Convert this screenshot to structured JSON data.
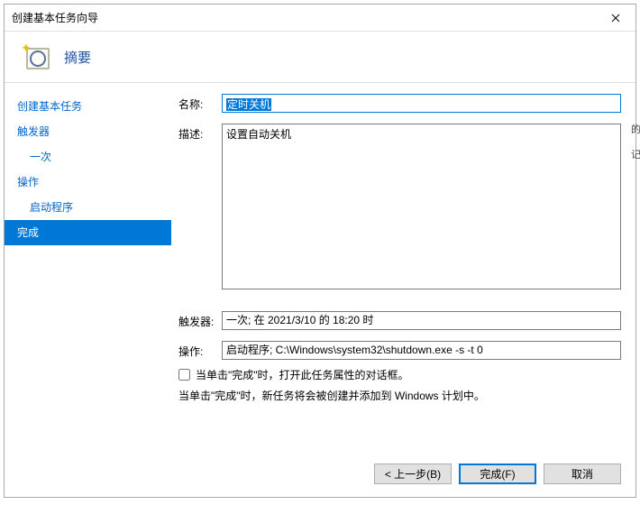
{
  "window": {
    "title": "创建基本任务向导"
  },
  "header": {
    "title": "摘要"
  },
  "sidebar": {
    "items": [
      {
        "label": "创建基本任务",
        "sub": false,
        "selected": false
      },
      {
        "label": "触发器",
        "sub": false,
        "selected": false
      },
      {
        "label": "一次",
        "sub": true,
        "selected": false
      },
      {
        "label": "操作",
        "sub": false,
        "selected": false
      },
      {
        "label": "启动程序",
        "sub": true,
        "selected": false
      },
      {
        "label": "完成",
        "sub": false,
        "selected": true
      }
    ]
  },
  "form": {
    "name_label": "名称:",
    "name_value": "定时关机",
    "desc_label": "描述:",
    "desc_value": "设置自动关机",
    "trigger_label": "触发器:",
    "trigger_value": "一次;  在 2021/3/10 的 18:20 时",
    "action_label": "操作:",
    "action_value": "启动程序; C:\\Windows\\system32\\shutdown.exe -s -t 0",
    "checkbox_label": "当单击\"完成\"时，打开此任务属性的对话框。",
    "info_text": "当单击\"完成\"时，新任务将会被创建并添加到 Windows 计划中。"
  },
  "buttons": {
    "back": "< 上一步(B)",
    "finish": "完成(F)",
    "cancel": "取消"
  },
  "strip": {
    "c1": "的",
    "c2": "记"
  }
}
